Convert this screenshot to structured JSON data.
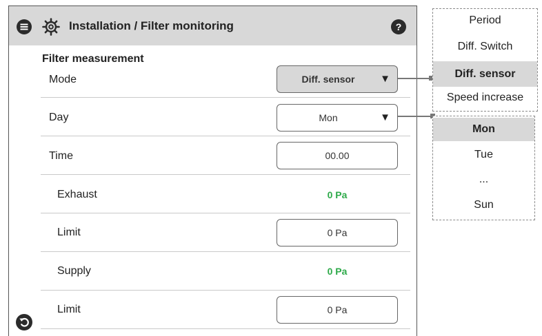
{
  "header": {
    "title": "Installation / Filter monitoring",
    "menu_icon": "menu-icon",
    "settings_icon": "gear-icon",
    "help_icon": "help-icon"
  },
  "section": {
    "title": "Filter measurement"
  },
  "rows": {
    "mode": {
      "label": "Mode",
      "value": "Diff. sensor",
      "arrow": "▼"
    },
    "day": {
      "label": "Day",
      "value": "Mon",
      "arrow": "▼"
    },
    "time": {
      "label": "Time",
      "value": "00.00"
    },
    "exhaust": {
      "label": "Exhaust",
      "value": "0 Pa"
    },
    "exhaust_limit": {
      "label": "Limit",
      "value": "0 Pa"
    },
    "supply": {
      "label": "Supply",
      "value": "0 Pa"
    },
    "supply_limit": {
      "label": "Limit",
      "value": "0 Pa"
    }
  },
  "mode_options": [
    "Period",
    "Diff. Switch",
    "Diff. sensor",
    "Speed increase"
  ],
  "mode_selected": "Diff. sensor",
  "day_options": [
    "Mon",
    "Tue",
    "...",
    "Sun"
  ],
  "day_selected": "Mon",
  "footer": {
    "back_icon": "back-icon"
  },
  "colors": {
    "header_bg": "#d8d8d8",
    "reading_green": "#2eaa4a",
    "border": "#666666"
  }
}
